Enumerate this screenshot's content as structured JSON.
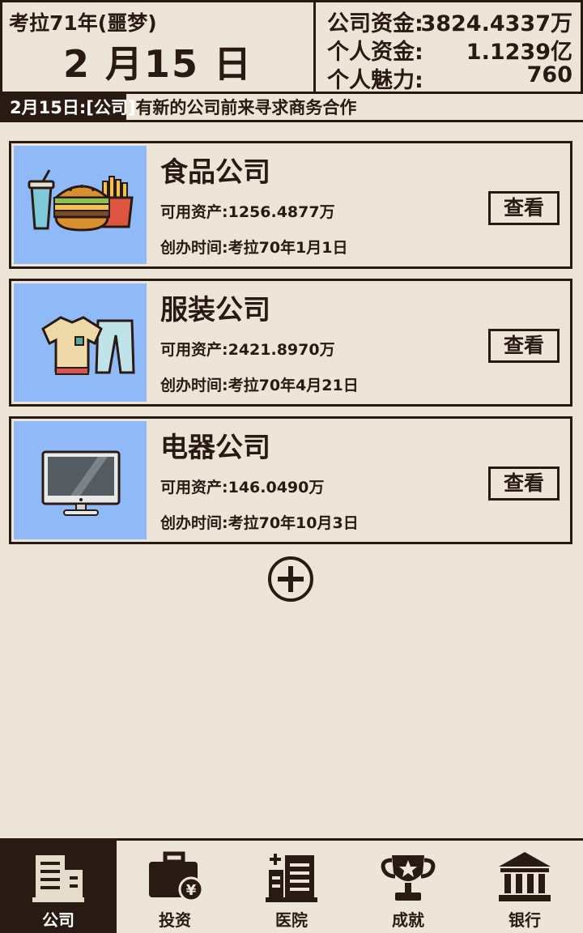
{
  "header": {
    "era": "考拉71年(噩梦)",
    "date": "2 月15 日",
    "company_funds_label": "公司资金:",
    "company_funds_value": "3824.4337万",
    "personal_funds_label": "个人资金:",
    "personal_funds_value": "1.1239亿",
    "charm_label": "个人魅力:",
    "charm_value": "760"
  },
  "ticker": {
    "date": "2月15日:",
    "prefix": "[公司]",
    "message": "有新的公司前来寻求商务合作"
  },
  "companies": [
    {
      "name": "食品公司",
      "assets": "可用资产:1256.4877万",
      "founded": "创办时间:考拉70年1月1日",
      "button": "查看",
      "icon": "food-icon"
    },
    {
      "name": "服装公司",
      "assets": "可用资产:2421.8970万",
      "founded": "创办时间:考拉70年4月21日",
      "button": "查看",
      "icon": "clothing-icon"
    },
    {
      "name": "电器公司",
      "assets": "可用资产:146.0490万",
      "founded": "创办时间:考拉70年10月3日",
      "button": "查看",
      "icon": "monitor-icon"
    }
  ],
  "add_button_icon": "plus-circle-icon",
  "tabs": [
    {
      "label": "公司",
      "icon": "building-icon",
      "active": true
    },
    {
      "label": "投资",
      "icon": "briefcase-icon",
      "active": false
    },
    {
      "label": "医院",
      "icon": "hospital-icon",
      "active": false
    },
    {
      "label": "成就",
      "icon": "trophy-icon",
      "active": false
    },
    {
      "label": "银行",
      "icon": "bank-icon",
      "active": false
    }
  ],
  "colors": {
    "dark": "#2a1a14",
    "background": "#ede6d8",
    "thumb": "#8fbaf7"
  }
}
